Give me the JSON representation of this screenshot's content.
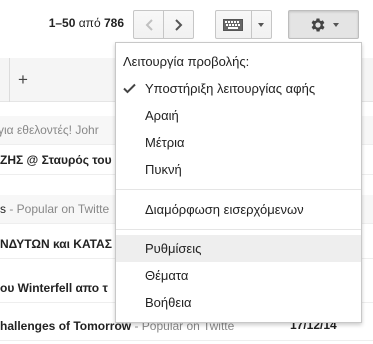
{
  "toolbar": {
    "pagination_range": "1–50",
    "pagination_of": "από",
    "pagination_total": "786",
    "prev_icon": "chevron-left-icon",
    "next_icon": "chevron-right-icon",
    "keyboard_icon": "keyboard-icon",
    "settings_icon": "gear-icon"
  },
  "tabs": {
    "add_label": "+"
  },
  "mail_rows": [
    {
      "subject": "",
      "snippet": "για εθελοντές! Johr",
      "read": true
    },
    {
      "subject": "ΖΗΣ @ Σταυρός του",
      "snippet": "",
      "read": false
    },
    {
      "subject": "s",
      "snippet": " - Popular on Twitte",
      "read": true
    },
    {
      "subject": "ΝΔΥΤΩΝ και ΚΑΤΑΣ",
      "snippet": "",
      "read": false
    },
    {
      "subject": "ου Winterfell απο τ",
      "snippet": "",
      "read": false
    },
    {
      "subject": "hallenges of Tomorrow",
      "snippet": " - Popular on Twitte",
      "read": false,
      "date": "17/12/14"
    }
  ],
  "settings_menu": {
    "heading": "Λειτουργία προβολής:",
    "display_options": [
      {
        "label": "Υποστήριξη λειτουργίας αφής",
        "checked": true
      },
      {
        "label": "Αραιή",
        "checked": false
      },
      {
        "label": "Μέτρια",
        "checked": false
      },
      {
        "label": "Πυκνή",
        "checked": false
      }
    ],
    "configure_inbox": "Διαμόρφωση εισερχόμενων",
    "settings": "Ρυθμίσεις",
    "themes": "Θέματα",
    "help": "Βοήθεια",
    "highlighted": "Ρυθμίσεις"
  },
  "colors": {
    "menu_hover": "#eeeeee",
    "menu_border": "#c8c8c8",
    "button_pressed": "#e4e4e4"
  }
}
